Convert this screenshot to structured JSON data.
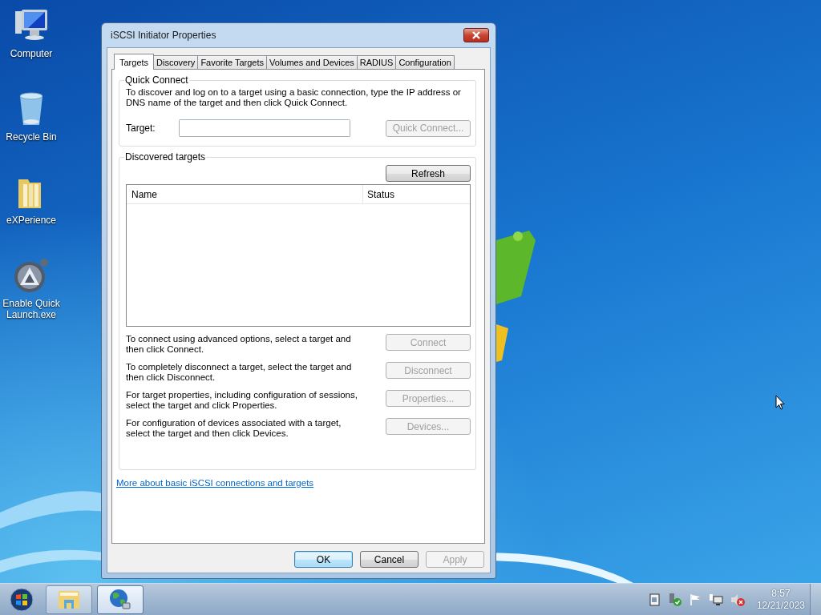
{
  "desktop": {
    "icons": [
      {
        "label": "Computer",
        "kind": "computer"
      },
      {
        "label": "Recycle Bin",
        "kind": "bin"
      },
      {
        "label": "eXPerience",
        "kind": "folder"
      },
      {
        "label": "Enable Quick Launch.exe",
        "kind": "app"
      }
    ]
  },
  "window": {
    "title": "iSCSI Initiator Properties",
    "tabs": [
      {
        "label": "Targets",
        "selected": true
      },
      {
        "label": "Discovery",
        "selected": false
      },
      {
        "label": "Favorite Targets",
        "selected": false
      },
      {
        "label": "Volumes and Devices",
        "selected": false
      },
      {
        "label": "RADIUS",
        "selected": false
      },
      {
        "label": "Configuration",
        "selected": false
      }
    ],
    "quick_connect": {
      "legend": "Quick Connect",
      "description": "To discover and log on to a target using a basic connection, type the IP address or DNS name of the target and then click Quick Connect.",
      "target_label": "Target:",
      "button": {
        "label": "Quick Connect...",
        "disabled": true
      }
    },
    "discovered_targets": {
      "legend": "Discovered targets",
      "refresh": {
        "label": "Refresh",
        "disabled": false
      },
      "columns": [
        "Name",
        "Status"
      ],
      "actions": [
        {
          "text": "To connect using advanced options, select a target and then click Connect.",
          "button": {
            "label": "Connect",
            "disabled": true
          }
        },
        {
          "text": "To completely disconnect a target, select the target and then click Disconnect.",
          "button": {
            "label": "Disconnect",
            "disabled": true
          }
        },
        {
          "text": "For target properties, including configuration of sessions, select the target and click Properties.",
          "button": {
            "label": "Properties...",
            "disabled": true
          }
        },
        {
          "text": "For configuration of devices associated with a target, select the target and then click Devices.",
          "button": {
            "label": "Devices...",
            "disabled": true
          }
        }
      ]
    },
    "link": "More about basic iSCSI connections and targets",
    "buttons": [
      {
        "label": "OK",
        "default": true,
        "disabled": false
      },
      {
        "label": "Cancel",
        "default": false,
        "disabled": false
      },
      {
        "label": "Apply",
        "default": false,
        "disabled": true
      }
    ]
  },
  "taskbar": {
    "apps": [
      {
        "kind": "explorer",
        "selected": false
      },
      {
        "kind": "network",
        "selected": true
      }
    ],
    "clock": {
      "time": "8:57",
      "date": "12/21/2023"
    }
  }
}
